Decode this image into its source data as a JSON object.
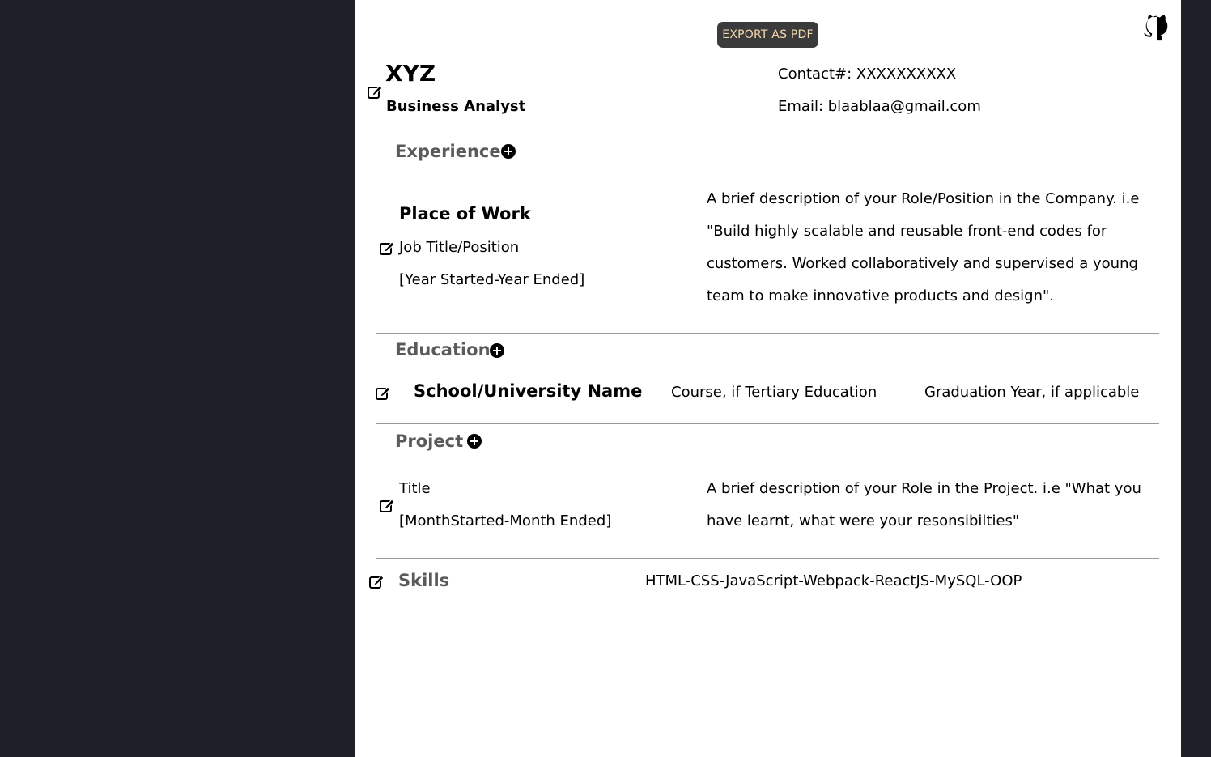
{
  "toolbar": {
    "export_label": "EXPORT AS PDF"
  },
  "icons": {
    "github": "github-icon",
    "edit": "pen-to-square-icon",
    "add": "plus-circle-icon"
  },
  "header": {
    "name": "XYZ",
    "role": "Business Analyst",
    "contact": "Contact#: XXXXXXXXXX",
    "email": "Email: blaablaa@gmail.com"
  },
  "experience": {
    "title": "Experience",
    "place": "Place of Work",
    "job_title": "Job Title/Position",
    "years": "[Year Started-Year Ended]",
    "description": "A brief description of your Role/Position in the Company. i.e \"Build highly scalable and reusable front-end codes for customers. Worked collaboratively and supervised a young team to make innovative products and design\"."
  },
  "education": {
    "title": "Education",
    "school": "School/University Name",
    "course": "Course, if Tertiary Education",
    "graduation": "Graduation Year, if applicable"
  },
  "project": {
    "title": "Project",
    "item_title": "Title",
    "months": "[MonthStarted-Month Ended]",
    "description": "A brief description of your Role in the Project. i.e \"What you have learnt, what were your resonsibilties\""
  },
  "skills": {
    "title": "Skills",
    "list": "HTML-CSS-JavaScript-Webpack-ReactJS-MySQL-OOP"
  },
  "colors": {
    "background": "#1f1f28",
    "page": "#ffffff",
    "button": "#3b3b3b",
    "button_text": "#f3d9b1",
    "section_title": "#5a5a5a"
  }
}
